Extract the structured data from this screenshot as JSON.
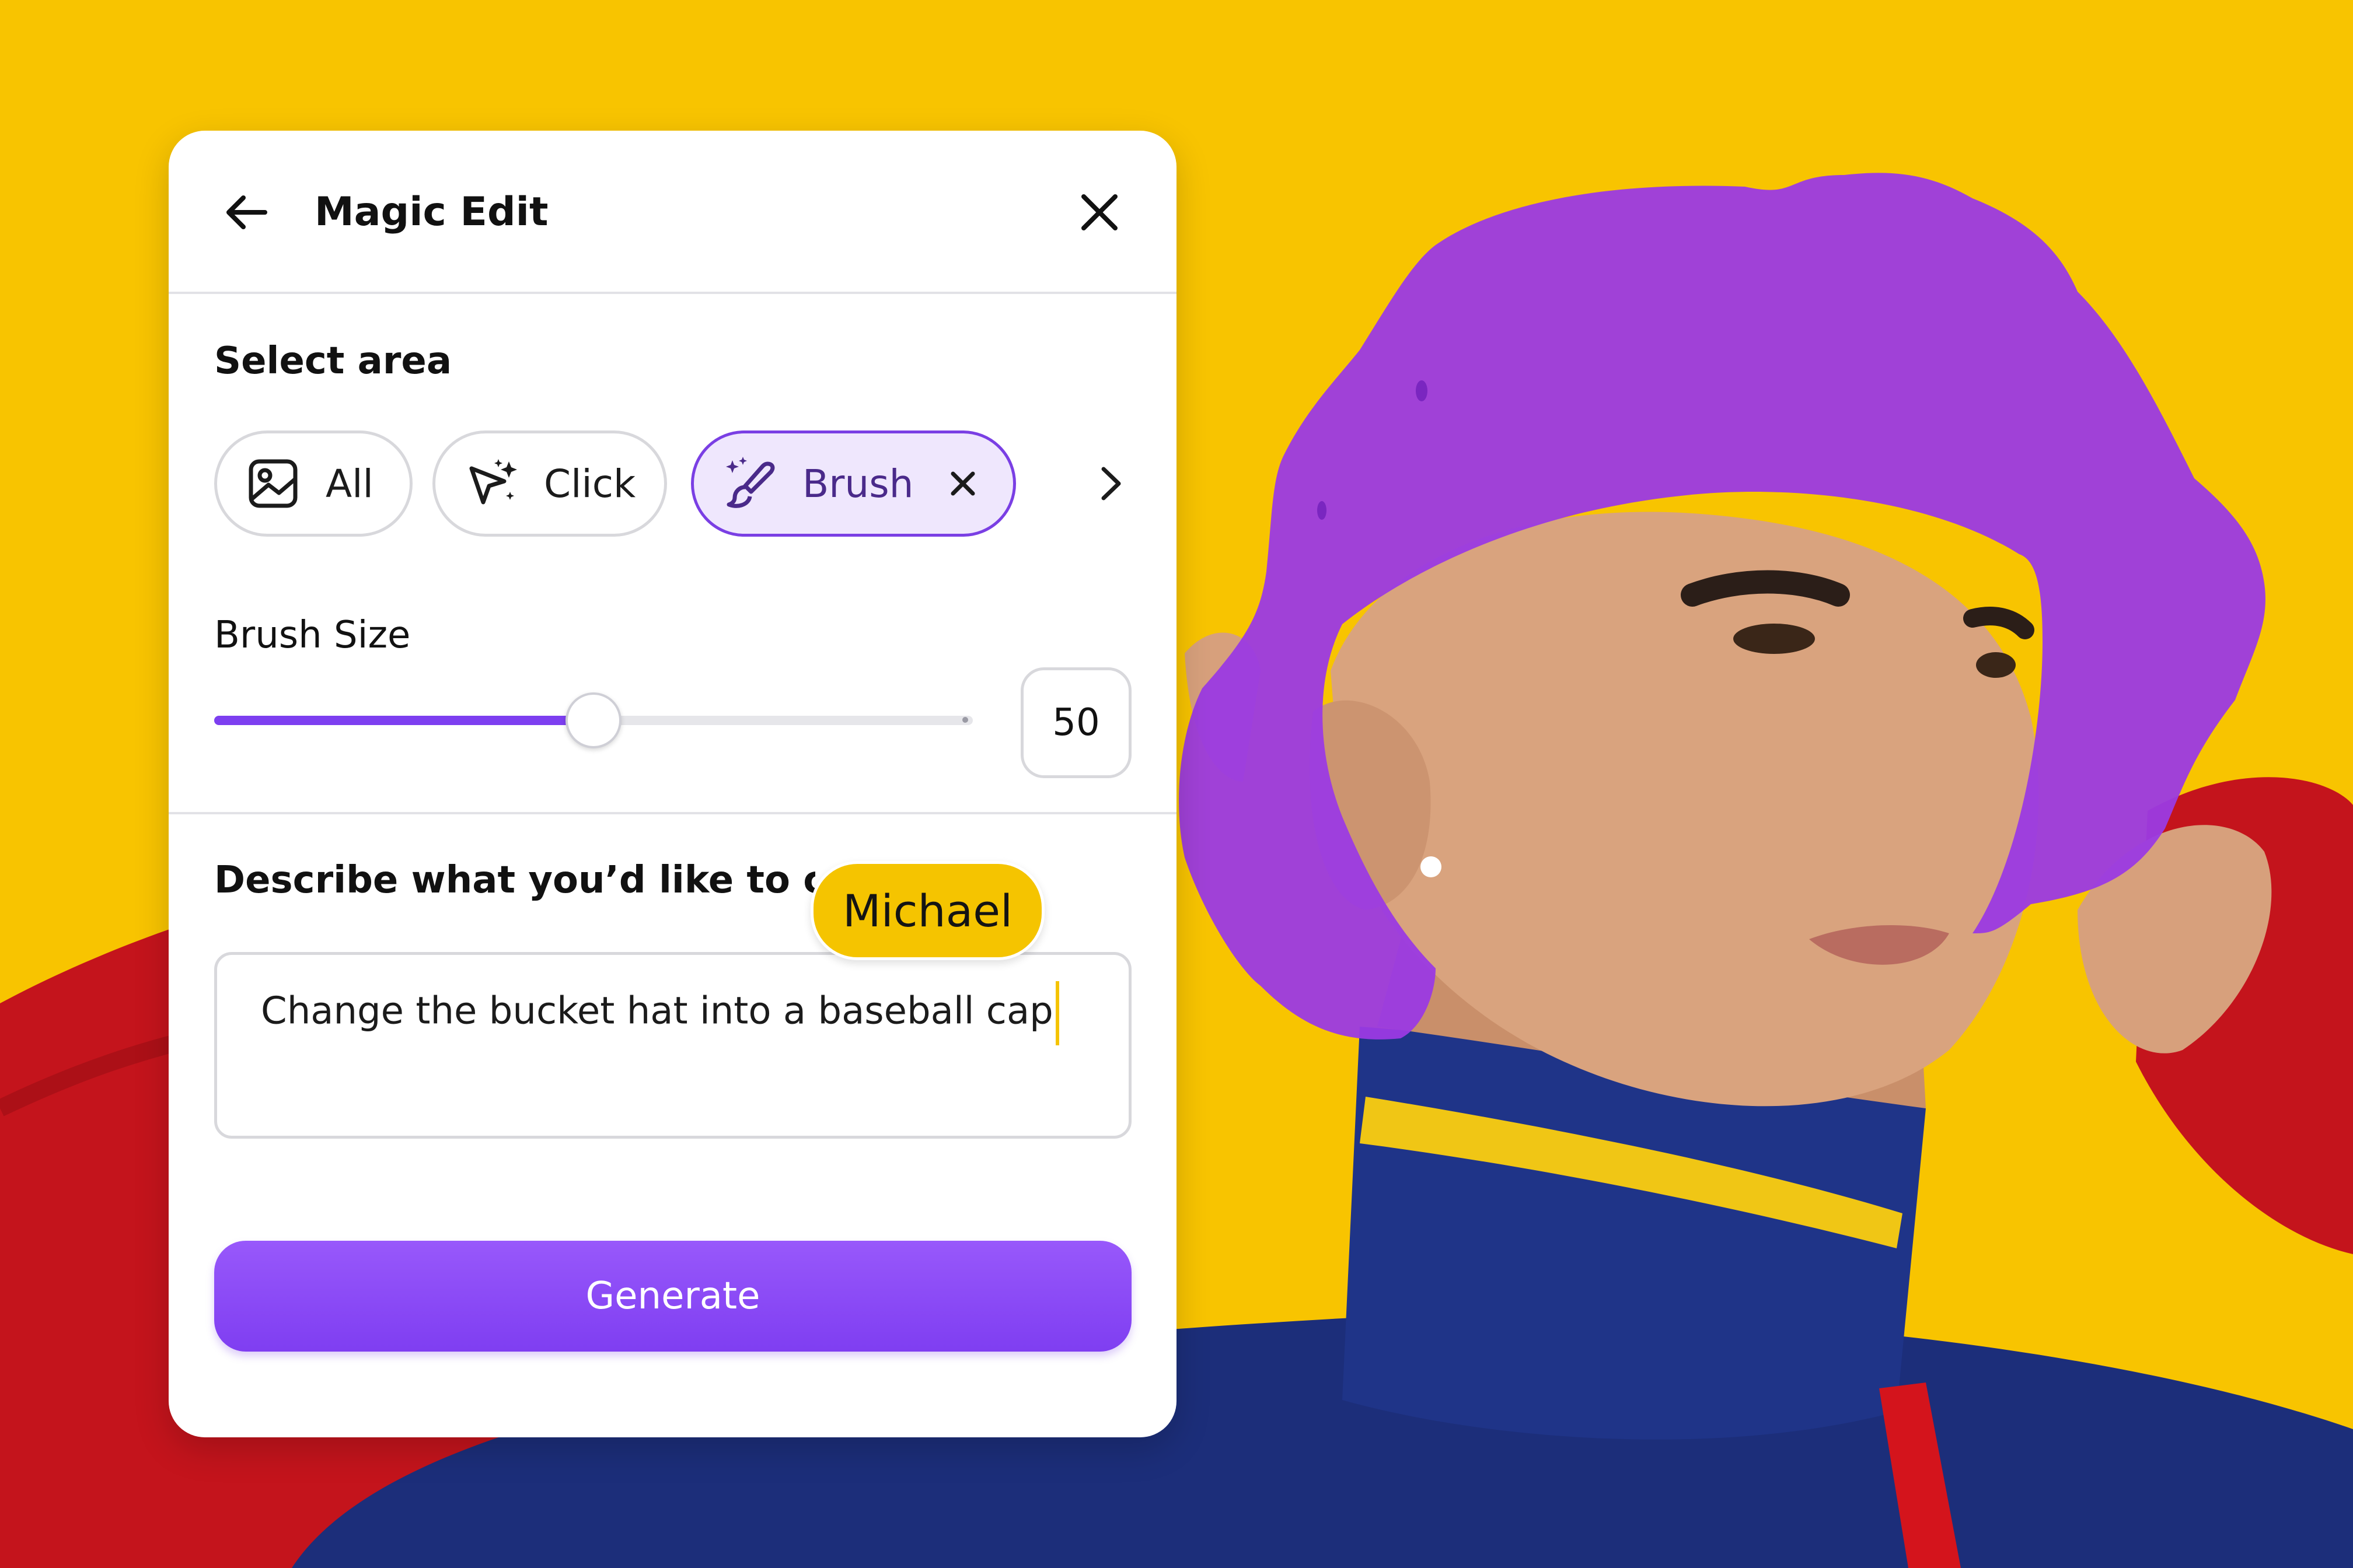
{
  "header": {
    "title": "Magic Edit",
    "back_icon": "arrow-left-icon",
    "close_icon": "close-icon"
  },
  "select_area": {
    "label": "Select area",
    "options": [
      {
        "label": "All",
        "icon": "image-icon",
        "selected": false
      },
      {
        "label": "Click",
        "icon": "magic-pointer-icon",
        "selected": false
      },
      {
        "label": "Brush",
        "icon": "magic-brush-icon",
        "selected": true
      }
    ],
    "more_icon": "chevron-right-icon"
  },
  "brush": {
    "label": "Brush Size",
    "value": "50",
    "slider_fraction": 0.5
  },
  "prompt": {
    "label": "Describe what you’d like to crea",
    "value": "Change the bucket hat into a baseball cap"
  },
  "collaborator": {
    "name": "Michael"
  },
  "actions": {
    "generate_label": "Generate"
  },
  "colors": {
    "accent": "#7D3FF0",
    "background": "#F7C300",
    "cursor": "#F5C400",
    "mask": "#9B3AE3"
  }
}
